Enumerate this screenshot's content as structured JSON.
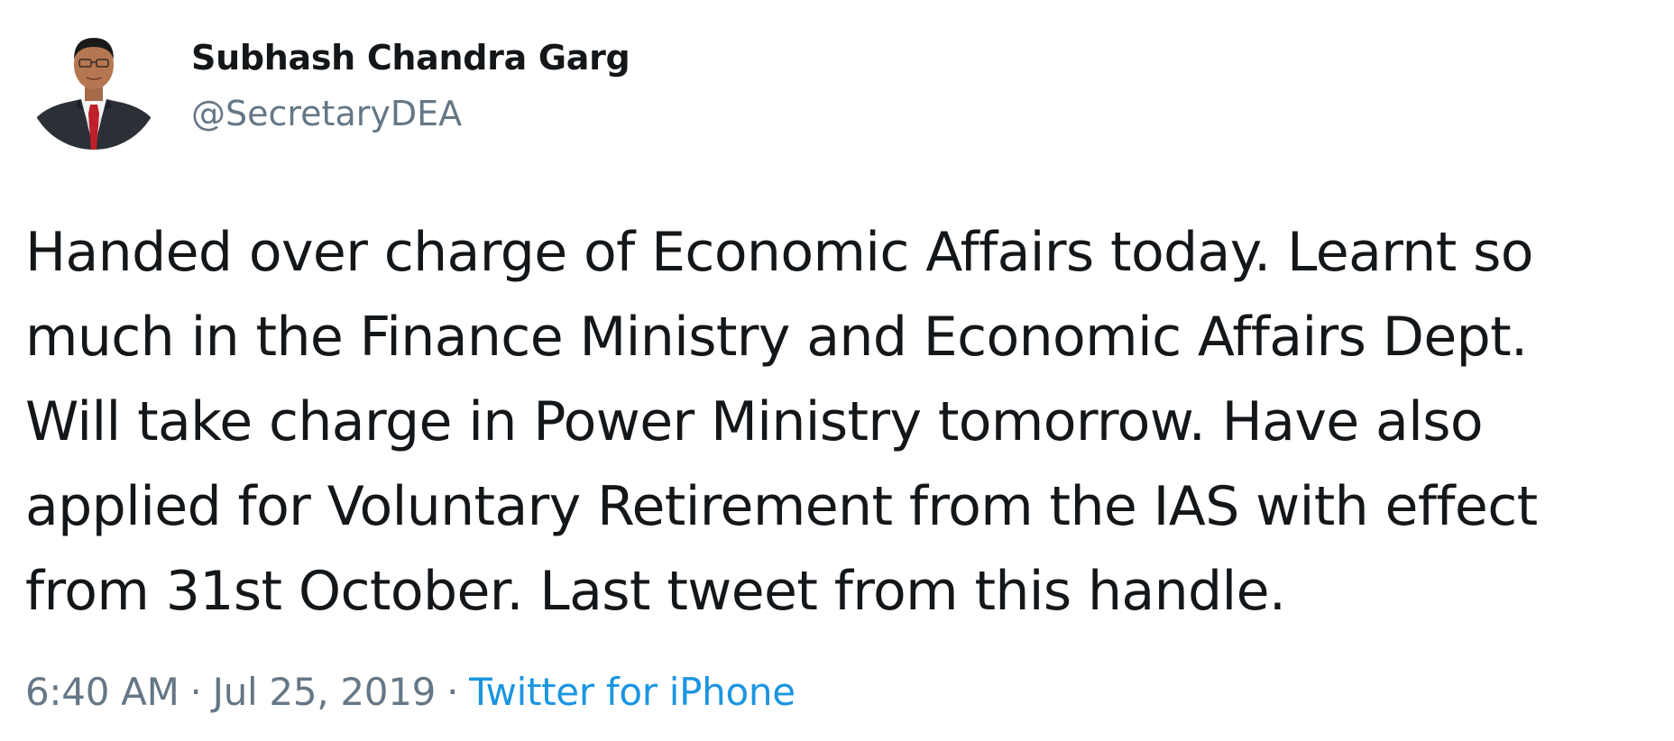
{
  "author": {
    "display_name": "Subhash Chandra Garg",
    "handle": "@SecretaryDEA",
    "avatar_icon": "profile-photo-man-in-suit"
  },
  "tweet": {
    "lines": [
      "Handed over charge of Economic Affairs today. Learnt so",
      "much in the Finance Ministry and Economic Affairs Dept.",
      "Will take charge in Power Ministry tomorrow. Have also",
      "applied for Voluntary Retirement from the IAS with effect",
      "from 31st October. Last tweet from this handle."
    ],
    "time": "6:40 AM",
    "date": "Jul 25, 2019",
    "separator": "·",
    "source": "Twitter for iPhone"
  },
  "colors": {
    "text": "#14171a",
    "secondary": "#657786",
    "link": "#1b95e0"
  }
}
